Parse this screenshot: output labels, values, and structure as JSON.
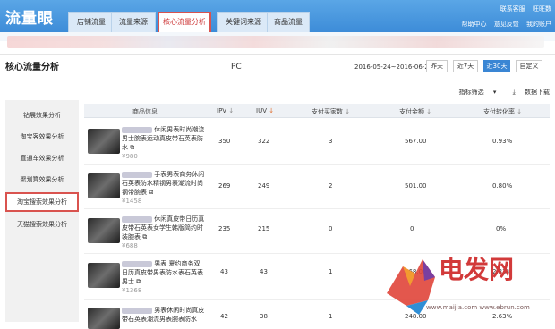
{
  "header": {
    "logo": "流量眼",
    "tabs": [
      {
        "label": "店铺流量",
        "active": false
      },
      {
        "label": "流量来源",
        "active": false
      },
      {
        "label": "核心流量分析",
        "active": true
      },
      {
        "label": "关键词来源",
        "active": false
      },
      {
        "label": "商品流量",
        "active": false
      }
    ],
    "top_links": [
      "联系客服",
      "旺旺数"
    ],
    "sub_links": [
      "帮助中心",
      "意见反馈",
      "我的账户"
    ]
  },
  "page": {
    "title": "核心流量分析",
    "platform": "PC",
    "date_range": "2016-05-24~2016-06-22",
    "date_buttons": [
      {
        "label": "昨天",
        "selected": false
      },
      {
        "label": "近7天",
        "selected": false
      },
      {
        "label": "近30天",
        "selected": true
      },
      {
        "label": "自定义",
        "selected": false
      }
    ],
    "filter_label": "指标筛选",
    "download_label": "数据下载"
  },
  "sidebar": {
    "items": [
      {
        "label": "钻展效果分析",
        "active": false
      },
      {
        "label": "淘宝客效果分析",
        "active": false
      },
      {
        "label": "直通车效果分析",
        "active": false
      },
      {
        "label": "聚划算效果分析",
        "active": false
      },
      {
        "label": "淘宝搜索效果分析",
        "active": true
      },
      {
        "label": "天猫搜索效果分析",
        "active": false
      }
    ]
  },
  "table": {
    "headers": [
      "商品信息",
      "IPV",
      "IUV",
      "支付买家数",
      "支付金额",
      "支付转化率"
    ],
    "rows": [
      {
        "name": "休闲男表时尚潮流男士腕表运动真皮带石英表防水",
        "price": "¥980",
        "ipv": "350",
        "iuv": "322",
        "buyers": "3",
        "amount": "567.00",
        "rate": "0.93%"
      },
      {
        "name": "手表男表商务休闲石英表防水精钢男表潮流时尚钢带腕表",
        "price": "¥1458",
        "ipv": "269",
        "iuv": "249",
        "buyers": "2",
        "amount": "501.00",
        "rate": "0.80%"
      },
      {
        "name": "休闲真皮带日历真皮带石英表女学生韩版简约时装腕表",
        "price": "¥688",
        "ipv": "235",
        "iuv": "215",
        "buyers": "0",
        "amount": "0",
        "rate": "0%"
      },
      {
        "name": "男表 夏约商务双日历真皮带男表防水表石英表男士",
        "price": "¥1368",
        "ipv": "43",
        "iuv": "43",
        "buyers": "1",
        "amount": "268.00",
        "rate": "2.33%"
      },
      {
        "name": "男表休闲时尚真皮带石英表潮流男表腕表防水",
        "price": "",
        "ipv": "42",
        "iuv": "38",
        "buyers": "1",
        "amount": "248.00",
        "rate": "2.63%"
      }
    ]
  },
  "watermark": {
    "text": "电发网",
    "url": "www.maijia.com  www.ebrun.com"
  }
}
